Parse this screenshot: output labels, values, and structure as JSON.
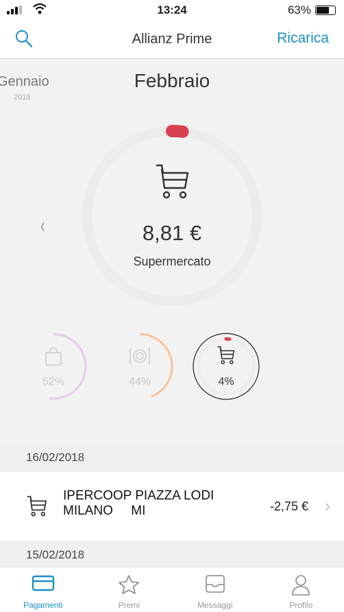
{
  "status": {
    "time": "13:24",
    "battery": "63%",
    "battery_level": 0.63
  },
  "nav": {
    "title": "Allianz Prime",
    "action": "Ricarica"
  },
  "months": {
    "prev": "Gennaio",
    "prev_year": "2018",
    "current": "Febbraio"
  },
  "summary": {
    "amount": "8,81 €",
    "category": "Supermercato",
    "progress": 0.04
  },
  "categories": [
    {
      "icon": "shopping-bag-icon",
      "percent": "52%",
      "value": 0.52,
      "color": "#e9c9ee"
    },
    {
      "icon": "restaurant-icon",
      "percent": "44%",
      "value": 0.44,
      "color": "#f6c29a"
    },
    {
      "icon": "cart-icon",
      "percent": "4%",
      "value": 0.04,
      "color": "#d94050"
    }
  ],
  "transactions": [
    {
      "date": "16/02/2018",
      "name": "IPERCOOP PIAZZA LODI\nMILANO     MI",
      "amount": "-2,75 €"
    },
    {
      "date": "15/02/2018"
    }
  ],
  "tabs": [
    {
      "label": "Pagamenti",
      "icon": "card-icon",
      "active": true
    },
    {
      "label": "Premi",
      "icon": "star-icon",
      "active": false
    },
    {
      "label": "Messaggi",
      "icon": "inbox-icon",
      "active": false
    },
    {
      "label": "Profilo",
      "icon": "person-icon",
      "active": false
    }
  ],
  "colors": {
    "accent": "#1a8fc9",
    "red": "#d94050",
    "ring_track": "#ececec"
  }
}
